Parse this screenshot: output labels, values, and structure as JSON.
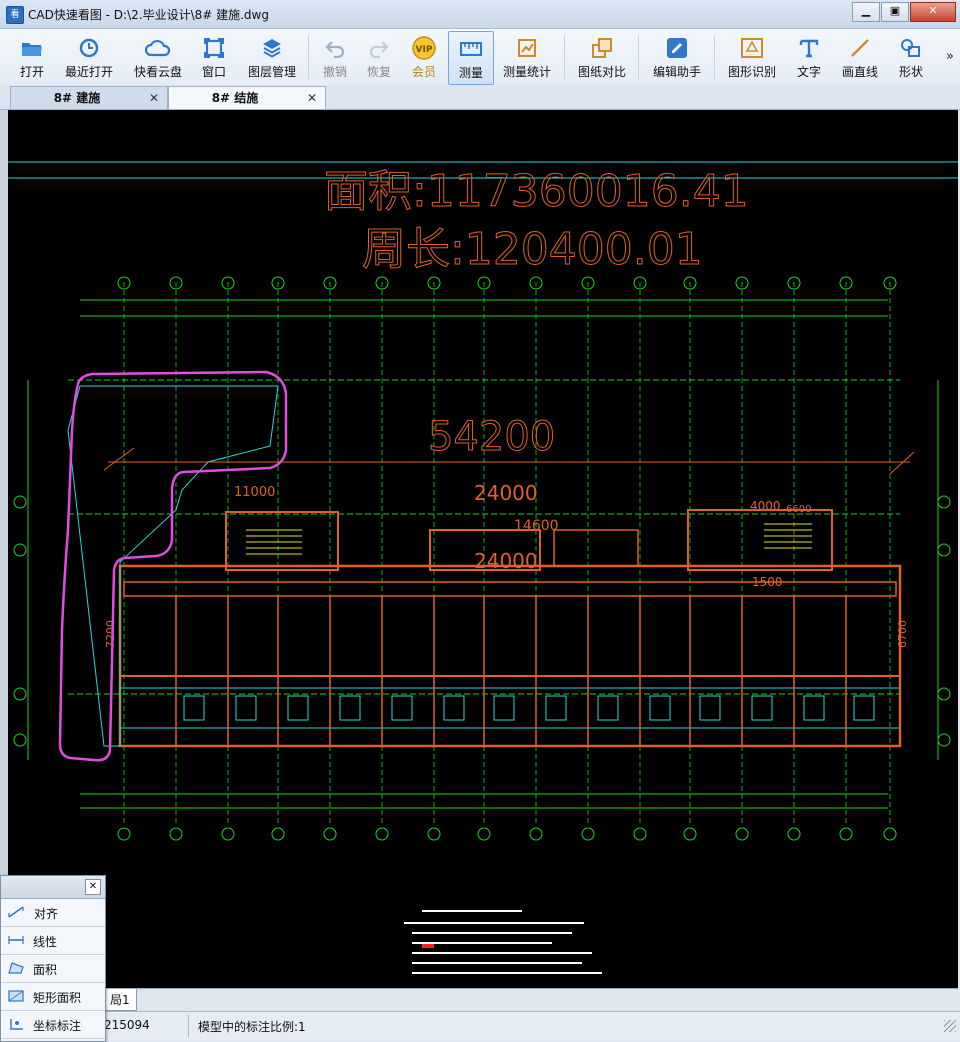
{
  "window": {
    "app_icon": "cad-app-icon",
    "title": "CAD快速看图 - D:\\2.毕业设计\\8# 建施.dwg",
    "minimize": "▁",
    "restore": "▣",
    "close": "✕"
  },
  "toolbar": {
    "items": [
      {
        "label": "打开",
        "icon": "folder-open-icon"
      },
      {
        "label": "最近打开",
        "icon": "history-icon"
      },
      {
        "label": "快看云盘",
        "icon": "cloud-icon"
      },
      {
        "label": "窗口",
        "icon": "window-icon"
      },
      {
        "label": "图层管理",
        "icon": "layers-icon"
      },
      {
        "label": "撤销",
        "icon": "undo-icon"
      },
      {
        "label": "恢复",
        "icon": "redo-icon"
      },
      {
        "label": "会员",
        "icon": "vip-badge-icon"
      },
      {
        "label": "测量",
        "icon": "measure-ruler-icon"
      },
      {
        "label": "测量统计",
        "icon": "measure-stats-icon"
      },
      {
        "label": "图纸对比",
        "icon": "compare-icon"
      },
      {
        "label": "编辑助手",
        "icon": "edit-assistant-icon"
      },
      {
        "label": "图形识别",
        "icon": "shape-recognize-icon"
      },
      {
        "label": "文字",
        "icon": "text-tool-icon"
      },
      {
        "label": "画直线",
        "icon": "line-tool-icon"
      },
      {
        "label": "形状",
        "icon": "shape-tool-icon"
      }
    ],
    "more": "»",
    "vip_text": "VIP"
  },
  "tabs": [
    {
      "name": "8# 建施",
      "close": "✕",
      "active": true
    },
    {
      "name": "8# 结施",
      "close": "✕",
      "active": false
    }
  ],
  "drawing": {
    "area_text": "面积:117360016.41",
    "perimeter_text": "周长:120400.01",
    "dim_total": "54200",
    "dim_24000_a": "24000",
    "dim_24000_b": "24000",
    "dim_14600": "14600",
    "dim_11000": "11000",
    "dim_4000": "4000",
    "dim_6600": "6600",
    "dim_1500": "1500",
    "dim_7200": "7200",
    "dim_6700": "6700",
    "axis_labels": [
      "①",
      "②",
      "③",
      "④",
      "⑤",
      "⑥",
      "⑦",
      "⑧",
      "⑨",
      "⑩",
      "⑪",
      "⑫",
      "⑬",
      "⑭",
      "⑮",
      "⑯"
    ],
    "colors": {
      "background": "#000000",
      "wall": "#e0602a",
      "axis": "#19d619",
      "cyan": "#27d7dc",
      "magenta": "#e04de0",
      "white": "#ffffff",
      "yellow": "#e6e01a",
      "red": "#ff2020"
    }
  },
  "layout_tab": "局1",
  "status": {
    "coord": "215094",
    "scale": "模型中的标注比例:1"
  },
  "measure_panel": {
    "close": "✕",
    "items": [
      {
        "label": "对齐",
        "icon": "align-measure-icon"
      },
      {
        "label": "线性",
        "icon": "linear-measure-icon"
      },
      {
        "label": "面积",
        "icon": "area-measure-icon"
      },
      {
        "label": "矩形面积",
        "icon": "rect-area-icon"
      },
      {
        "label": "坐标标注",
        "icon": "coordinate-icon"
      }
    ]
  }
}
